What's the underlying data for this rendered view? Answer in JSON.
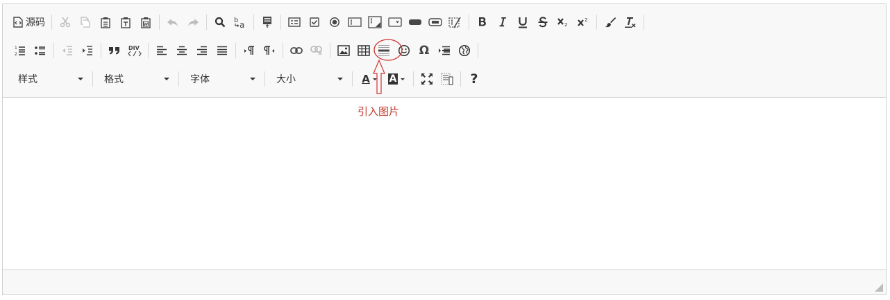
{
  "toolbar": {
    "source_label": "源码",
    "combos": [
      {
        "name": "style",
        "label": "样式"
      },
      {
        "name": "format",
        "label": "格式"
      },
      {
        "name": "font",
        "label": "字体"
      },
      {
        "name": "size",
        "label": "大小"
      }
    ],
    "help_glyph": "?",
    "omega_glyph": "Ω",
    "text_color_glyph": "A",
    "bg_color_glyph": "A"
  },
  "annotation": {
    "label": "引入图片",
    "color": "#c0392b"
  },
  "colors": {
    "icon": "#474747",
    "icon_disabled": "#bdbdbd",
    "toolbar_bg": "#f8f8f8",
    "border": "#d1d1d1"
  }
}
